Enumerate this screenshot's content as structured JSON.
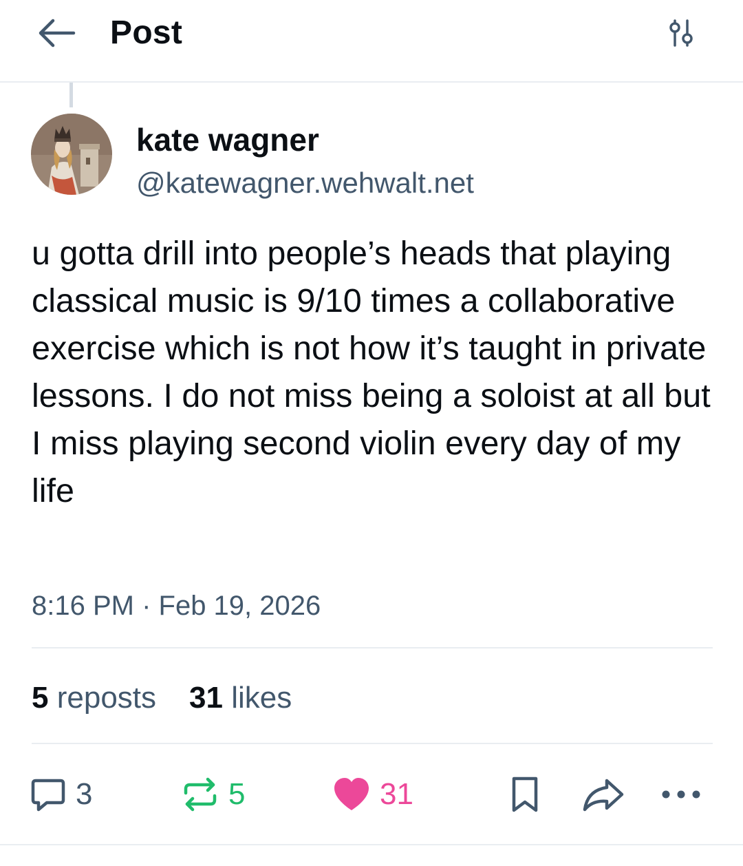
{
  "header": {
    "title": "Post",
    "back_icon": "arrow-left-icon",
    "settings_icon": "sliders-icon"
  },
  "author": {
    "name": "kate wagner",
    "handle": "@katewagner.wehwalt.net",
    "avatar": "medieval-portrait-avatar"
  },
  "post": {
    "text": "u gotta drill into people’s heads that playing classical music is 9/10 times a collaborative exercise which is not how it’s taught in private lessons. I do not miss being a soloist at all but I miss playing second violin every day of my life",
    "timestamp": "8:16 PM · Feb 19, 2026"
  },
  "stats": {
    "reposts_count": "5",
    "reposts_label": "reposts",
    "likes_count": "31",
    "likes_label": "likes"
  },
  "actions": {
    "reply_count": "3",
    "repost_count": "5",
    "like_count": "31",
    "reply_icon": "comment-icon",
    "repost_icon": "repost-icon",
    "like_icon": "heart-icon",
    "bookmark_icon": "bookmark-icon",
    "share_icon": "share-icon",
    "more_icon": "more-dots-icon"
  },
  "colors": {
    "text": "#0b0f14",
    "muted": "#42576c",
    "repost_active": "#20bc6b",
    "like_active": "#ec4899",
    "divider": "#e9edf1"
  }
}
